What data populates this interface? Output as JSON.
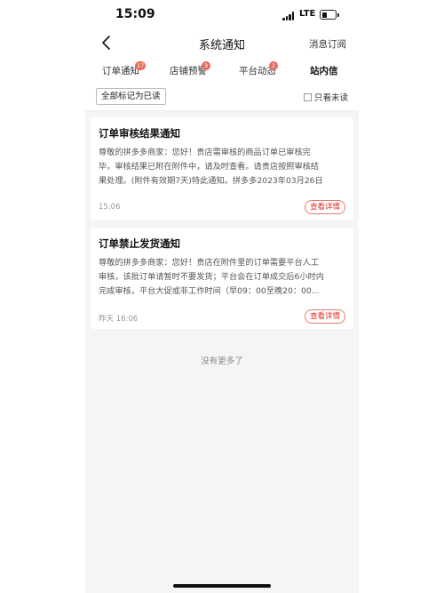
{
  "status_bar": {
    "time": "15:09",
    "network": "LTE",
    "battery_level": 0.4
  },
  "navbar": {
    "title": "系统通知",
    "right_action": "消息订阅",
    "back_icon": "chevron-left-icon"
  },
  "tabs": [
    {
      "label": "订单通知",
      "badge": "17"
    },
    {
      "label": "店铺预警",
      "badge": "3"
    },
    {
      "label": "平台动态",
      "badge": "2"
    },
    {
      "label": "站内信",
      "badge": ""
    }
  ],
  "toolbar": {
    "mark_all_read": "全部标记为已读",
    "only_unread": "只看未读",
    "only_unread_checked": false
  },
  "messages": [
    {
      "title": "订单审核结果通知",
      "body_lines": [
        "尊敬的拼多多商家：您好！贵店需审核的商品订单已审核完",
        "毕，审核结果已附在附件中，请及时查看。请贵店按照审核结",
        "果处理。(附件有效期7天)特此通知。拼多多2023年03月26日"
      ],
      "time": "15:06",
      "action": "查看详情"
    },
    {
      "title": "订单禁止发货通知",
      "body_lines": [
        "尊敬的拼多多商家：您好！贵店在附件里的订单需要平台人工",
        "审核，该批订单请暂时不要发货；平台会在订单成交后6小时内",
        "完成审核，平台大促或非工作时间（早09：00至晚20：00..."
      ],
      "time": "昨天 16:06",
      "action": "查看详情"
    }
  ],
  "footer": {
    "no_more": "没有更多了"
  },
  "colors": {
    "accent": "#e02e24",
    "badge": "#e96b5c",
    "background": "#f5f5f5"
  }
}
